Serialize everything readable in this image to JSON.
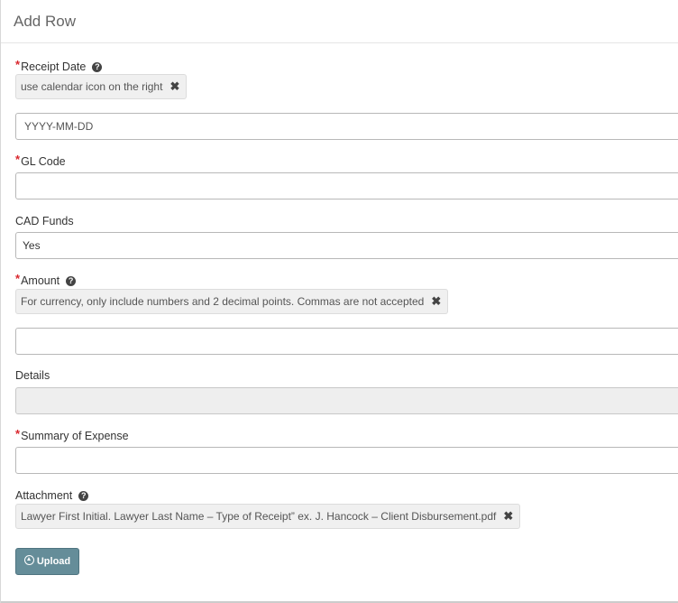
{
  "modal": {
    "title": "Add Row"
  },
  "fields": {
    "receipt_date": {
      "label": "Receipt Date",
      "required": "*",
      "help_icon": "question-circle-icon",
      "hint": "use calendar icon on the right",
      "placeholder": "YYYY-MM-DD",
      "value": ""
    },
    "gl_code": {
      "label": "GL Code",
      "required": "*",
      "value": ""
    },
    "cad_funds": {
      "label": "CAD Funds",
      "value": "Yes"
    },
    "amount": {
      "label": "Amount",
      "required": "*",
      "help_icon": "question-circle-icon",
      "hint": "For currency, only include numbers and 2 decimal points. Commas are not accepted",
      "value": ""
    },
    "details": {
      "label": "Details",
      "value": ""
    },
    "summary": {
      "label": "Summary of Expense",
      "required": "*",
      "value": ""
    },
    "attachment": {
      "label": "Attachment",
      "help_icon": "question-circle-icon",
      "hint": "Lawyer First Initial. Lawyer Last Name – Type of Receipt” ex. J. Hancock – Client Disbursement.pdf",
      "upload_label": "Upload",
      "upload_icon": "upload-circle-icon"
    }
  },
  "icons": {
    "close": "✖",
    "help": "?"
  },
  "colors": {
    "required": "#d9262d",
    "upload_button": "#658d99",
    "hint_background": "#f0f0f0",
    "readonly_background": "#eeeeee"
  }
}
